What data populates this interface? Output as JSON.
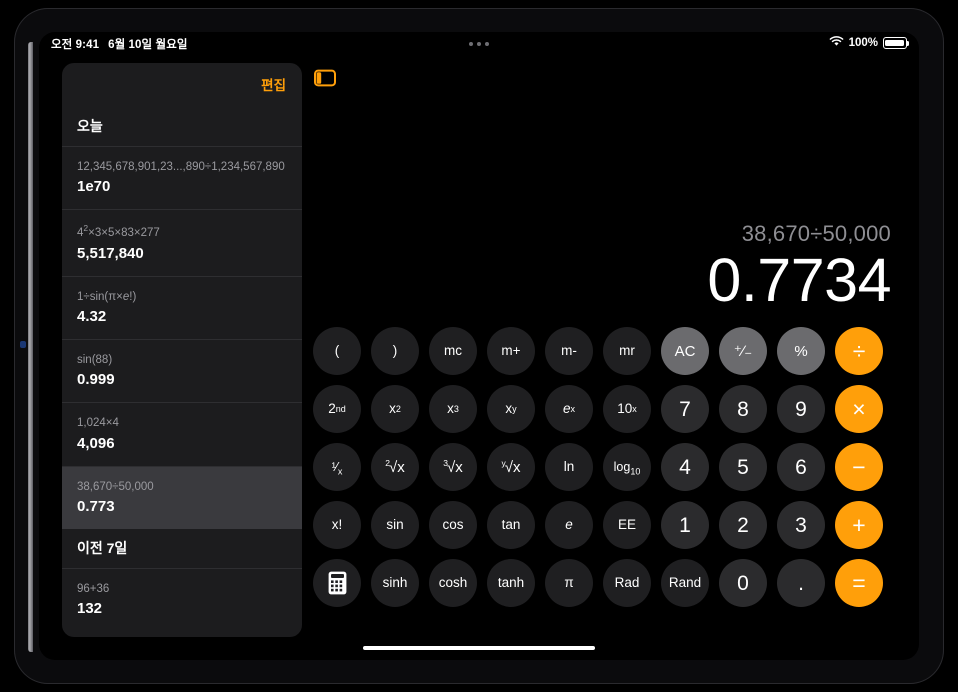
{
  "status_bar": {
    "time": "오전 9:41",
    "date": "6월 10일 월요일",
    "battery_percent": "100%",
    "wifi_icon": "wifi-icon",
    "battery_icon": "battery-icon",
    "multitask_icon": "ellipsis-icon"
  },
  "sidebar": {
    "edit_label": "편집",
    "toggle_icon": "sidebar-toggle-icon",
    "sections": [
      {
        "title": "오늘",
        "entries": [
          {
            "expression": "12,345,678,901,23...,890÷1,234,567,890",
            "result": "1e70",
            "selected": false
          },
          {
            "expression": "4²×3×5×83×277",
            "result": "5,517,840",
            "selected": false
          },
          {
            "expression": "1÷sin(π×e!)",
            "result": "4.32",
            "selected": false
          },
          {
            "expression": "sin(88)",
            "result": "0.999",
            "selected": false
          },
          {
            "expression": "1,024×4",
            "result": "4,096",
            "selected": false
          },
          {
            "expression": "38,670÷50,000",
            "result": "0.773",
            "selected": true
          }
        ]
      },
      {
        "title": "이전 7일",
        "entries": [
          {
            "expression": "96+36",
            "result": "132",
            "selected": false
          }
        ]
      }
    ]
  },
  "display": {
    "expression": "38,670÷50,000",
    "result": "0.7734"
  },
  "keypad": {
    "rows": [
      [
        {
          "label": "(",
          "kind": "fn",
          "name": "open-paren"
        },
        {
          "label": ")",
          "kind": "fn",
          "name": "close-paren"
        },
        {
          "label": "mc",
          "kind": "fn",
          "name": "memory-clear"
        },
        {
          "label": "m+",
          "kind": "fn",
          "name": "memory-add"
        },
        {
          "label": "m-",
          "kind": "fn",
          "name": "memory-subtract"
        },
        {
          "label": "mr",
          "kind": "fn",
          "name": "memory-recall"
        },
        {
          "label": "AC",
          "kind": "util",
          "name": "all-clear"
        },
        {
          "label": "⁺⁄₋",
          "kind": "util",
          "name": "sign-toggle"
        },
        {
          "label": "%",
          "kind": "util",
          "name": "percent"
        },
        {
          "label": "÷",
          "kind": "op",
          "name": "divide"
        }
      ],
      [
        {
          "label": "2nd",
          "kind": "fn",
          "name": "second-function"
        },
        {
          "label": "x²",
          "kind": "fn",
          "name": "x-squared"
        },
        {
          "label": "x³",
          "kind": "fn",
          "name": "x-cubed"
        },
        {
          "label": "xʸ",
          "kind": "fn",
          "name": "x-to-the-y"
        },
        {
          "label": "eˣ",
          "kind": "fn",
          "name": "e-to-the-x"
        },
        {
          "label": "10ˣ",
          "kind": "fn",
          "name": "ten-to-the-x"
        },
        {
          "label": "7",
          "kind": "digit",
          "name": "digit-7"
        },
        {
          "label": "8",
          "kind": "digit",
          "name": "digit-8"
        },
        {
          "label": "9",
          "kind": "digit",
          "name": "digit-9"
        },
        {
          "label": "×",
          "kind": "op",
          "name": "multiply"
        }
      ],
      [
        {
          "label": "⅟x",
          "kind": "fn",
          "name": "reciprocal"
        },
        {
          "label": "²√x",
          "kind": "fn",
          "name": "square-root"
        },
        {
          "label": "³√x",
          "kind": "fn",
          "name": "cube-root"
        },
        {
          "label": "ʸ√x",
          "kind": "fn",
          "name": "nth-root"
        },
        {
          "label": "ln",
          "kind": "fn",
          "name": "natural-log"
        },
        {
          "label": "log₁₀",
          "kind": "fn",
          "name": "log-base-10"
        },
        {
          "label": "4",
          "kind": "digit",
          "name": "digit-4"
        },
        {
          "label": "5",
          "kind": "digit",
          "name": "digit-5"
        },
        {
          "label": "6",
          "kind": "digit",
          "name": "digit-6"
        },
        {
          "label": "−",
          "kind": "op",
          "name": "subtract"
        }
      ],
      [
        {
          "label": "x!",
          "kind": "fn",
          "name": "factorial"
        },
        {
          "label": "sin",
          "kind": "fn",
          "name": "sine"
        },
        {
          "label": "cos",
          "kind": "fn",
          "name": "cosine"
        },
        {
          "label": "tan",
          "kind": "fn",
          "name": "tangent"
        },
        {
          "label": "e",
          "kind": "fn",
          "name": "euler-constant"
        },
        {
          "label": "EE",
          "kind": "fn",
          "name": "exponent-entry"
        },
        {
          "label": "1",
          "kind": "digit",
          "name": "digit-1"
        },
        {
          "label": "2",
          "kind": "digit",
          "name": "digit-2"
        },
        {
          "label": "3",
          "kind": "digit",
          "name": "digit-3"
        },
        {
          "label": "+",
          "kind": "op",
          "name": "add"
        }
      ],
      [
        {
          "label": "",
          "kind": "fn",
          "name": "keypad-mode-icon"
        },
        {
          "label": "sinh",
          "kind": "fn",
          "name": "hyperbolic-sine"
        },
        {
          "label": "cosh",
          "kind": "fn",
          "name": "hyperbolic-cosine"
        },
        {
          "label": "tanh",
          "kind": "fn",
          "name": "hyperbolic-tangent"
        },
        {
          "label": "π",
          "kind": "fn",
          "name": "pi-constant"
        },
        {
          "label": "Rad",
          "kind": "fn",
          "name": "radian-mode"
        },
        {
          "label": "Rand",
          "kind": "fn",
          "name": "random-number"
        },
        {
          "label": "0",
          "kind": "digit",
          "name": "digit-0"
        },
        {
          "label": ".",
          "kind": "digit",
          "name": "decimal-point"
        },
        {
          "label": "=",
          "kind": "op",
          "name": "equals"
        }
      ]
    ]
  },
  "colors": {
    "accent_orange": "#ff9f0a",
    "util_gray": "#6b6b6e",
    "digit_gray": "#2b2b2d",
    "fn_gray": "#1f1f21",
    "sidebar_bg": "#1c1c1e",
    "selected_row": "#3a3a3e"
  }
}
